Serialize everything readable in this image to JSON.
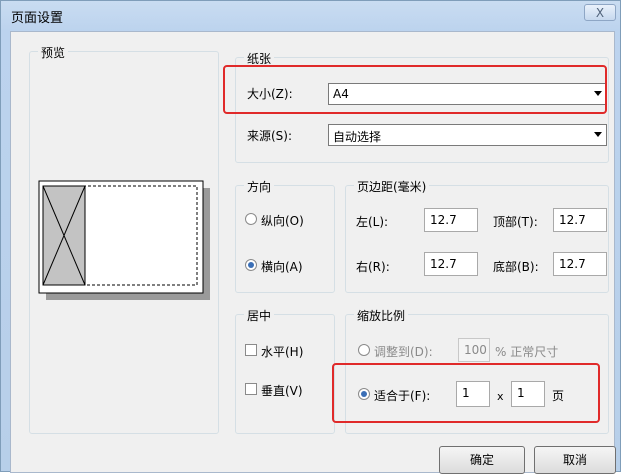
{
  "window": {
    "title": "页面设置",
    "close_label": "X"
  },
  "preview": {
    "label": "预览"
  },
  "paper": {
    "label": "纸张",
    "size_label": "大小(Z):",
    "size_value": "A4",
    "source_label": "来源(S):",
    "source_value": "自动选择"
  },
  "orientation": {
    "label": "方向",
    "portrait": "纵向(O)",
    "landscape": "横向(A)",
    "selected": "landscape"
  },
  "margins": {
    "label": "页边距(毫米)",
    "left_label": "左(L):",
    "left_value": "12.7",
    "top_label": "顶部(T):",
    "top_value": "12.7",
    "right_label": "右(R):",
    "right_value": "12.7",
    "bottom_label": "底部(B):",
    "bottom_value": "12.7"
  },
  "center": {
    "label": "居中",
    "horizontal": "水平(H)",
    "vertical": "垂直(V)"
  },
  "scaling": {
    "label": "缩放比例",
    "adjust_label": "调整到(D):",
    "adjust_value": "100",
    "adjust_unit": "% 正常尺寸",
    "fit_label": "适合于(F):",
    "fit_wide": "1",
    "fit_x": "x",
    "fit_tall": "1",
    "fit_unit": "页",
    "selected": "fit"
  },
  "buttons": {
    "ok": "确定",
    "cancel": "取消"
  },
  "colors": {
    "highlight": "#e02a2a",
    "radio_selected": "#3b6fb6"
  }
}
